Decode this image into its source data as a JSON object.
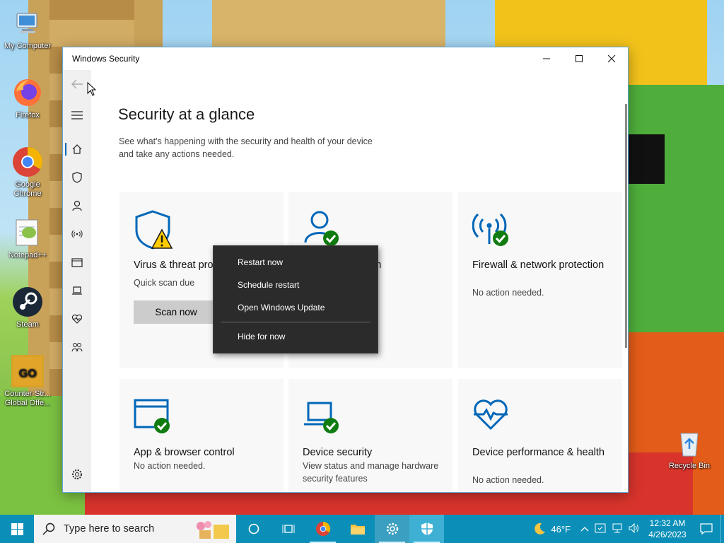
{
  "desktop": {
    "icons": [
      {
        "label": "My Computer"
      },
      {
        "label": "Firefox"
      },
      {
        "label": "Google Chrome"
      },
      {
        "label": "Notepad++"
      },
      {
        "label": "Steam"
      },
      {
        "label": "Counter-Str... Global Offe..."
      },
      {
        "label": "Recycle Bin"
      }
    ]
  },
  "window": {
    "title": "Windows Security",
    "page_title": "Security at a glance",
    "page_subtitle": "See what's happening with the security and health of your device and take any actions needed.",
    "tiles": [
      {
        "name": "Virus & threat protection",
        "name_visible": "Virus & threat pro",
        "status": "Quick scan due",
        "button": "Scan now",
        "icon": "shield-warning-icon"
      },
      {
        "name": "Account protection",
        "name_visible": "ion",
        "status": "",
        "icon": "person-check-icon"
      },
      {
        "name": "Firewall & network protection",
        "status": "No action needed.",
        "icon": "antenna-check-icon"
      },
      {
        "name": "App & browser control",
        "status": "No action needed.",
        "icon": "browser-check-icon"
      },
      {
        "name": "Device security",
        "status": "View status and manage hardware security features",
        "icon": "laptop-check-icon"
      },
      {
        "name": "Device performance & health",
        "status": "No action needed.",
        "icon": "heart-pulse-icon"
      }
    ],
    "nav": [
      "back-icon",
      "menu-icon",
      "home-icon",
      "shield-icon",
      "person-icon",
      "antenna-icon",
      "browser-icon",
      "laptop-icon",
      "heart-icon",
      "family-icon",
      "settings-icon"
    ]
  },
  "context_menu": {
    "items": [
      "Restart now",
      "Schedule restart",
      "Open Windows Update",
      "Hide for now"
    ]
  },
  "taskbar": {
    "search_placeholder": "Type here to search",
    "weather": "46°F",
    "time": "12:32 AM",
    "date": "4/26/2023"
  },
  "colors": {
    "accent": "#0067b8",
    "check": "#107c10",
    "warning": "#ffcc00",
    "taskbar": "#0b8fb8"
  }
}
